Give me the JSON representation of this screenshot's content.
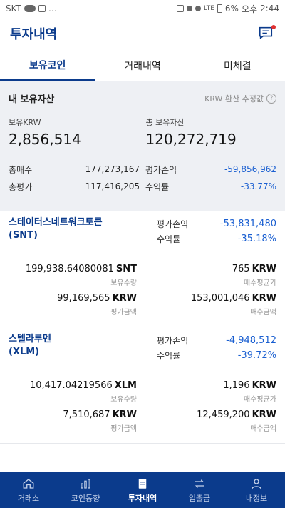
{
  "status": {
    "carrier": "SKT",
    "battery": "6%",
    "ampm": "오후",
    "time": "2:44"
  },
  "header": {
    "title": "투자내역"
  },
  "tabs": [
    {
      "label": "보유코인"
    },
    {
      "label": "거래내역"
    },
    {
      "label": "미체결"
    }
  ],
  "summary": {
    "title": "내 보유자산",
    "note": "KRW 환산 추정값",
    "krw_label": "보유KRW",
    "krw_value": "2,856,514",
    "total_label": "총 보유자산",
    "total_value": "120,272,719",
    "buy_label": "총매수",
    "buy_value": "177,273,167",
    "eval_label": "총평가",
    "eval_value": "117,416,205",
    "pl_label": "평가손익",
    "pl_value": "-59,856,962",
    "rate_label": "수익률",
    "rate_value": "-33.77%"
  },
  "coins": [
    {
      "name": "스테이터스네트워크토큰",
      "symbol": "(SNT)",
      "pl_label": "평가손익",
      "pl_value": "-53,831,480",
      "rate_label": "수익률",
      "rate_value": "-35.18%",
      "qty": "199,938.64080081",
      "qty_unit": "SNT",
      "qty_label": "보유수량",
      "avg": "765",
      "avg_unit": "KRW",
      "avg_label": "매수평균가",
      "eval": "99,169,565",
      "eval_unit": "KRW",
      "eval_label": "평가금액",
      "buy": "153,001,046",
      "buy_unit": "KRW",
      "buy_label": "매수금액"
    },
    {
      "name": "스텔라루멘",
      "symbol": "(XLM)",
      "pl_label": "평가손익",
      "pl_value": "-4,948,512",
      "rate_label": "수익률",
      "rate_value": "-39.72%",
      "qty": "10,417.04219566",
      "qty_unit": "XLM",
      "qty_label": "보유수량",
      "avg": "1,196",
      "avg_unit": "KRW",
      "avg_label": "매수평균가",
      "eval": "7,510,687",
      "eval_unit": "KRW",
      "eval_label": "평가금액",
      "buy": "12,459,200",
      "buy_unit": "KRW",
      "buy_label": "매수금액"
    }
  ],
  "nav": [
    {
      "label": "거래소",
      "icon": "home-icon"
    },
    {
      "label": "코인동향",
      "icon": "bar-chart-icon"
    },
    {
      "label": "투자내역",
      "icon": "document-icon"
    },
    {
      "label": "입출금",
      "icon": "transfer-icon"
    },
    {
      "label": "내정보",
      "icon": "user-icon"
    }
  ],
  "colors": {
    "brand": "#0b3b8c",
    "negative": "#1a5fd1",
    "summary_bg": "#eef0f4"
  }
}
